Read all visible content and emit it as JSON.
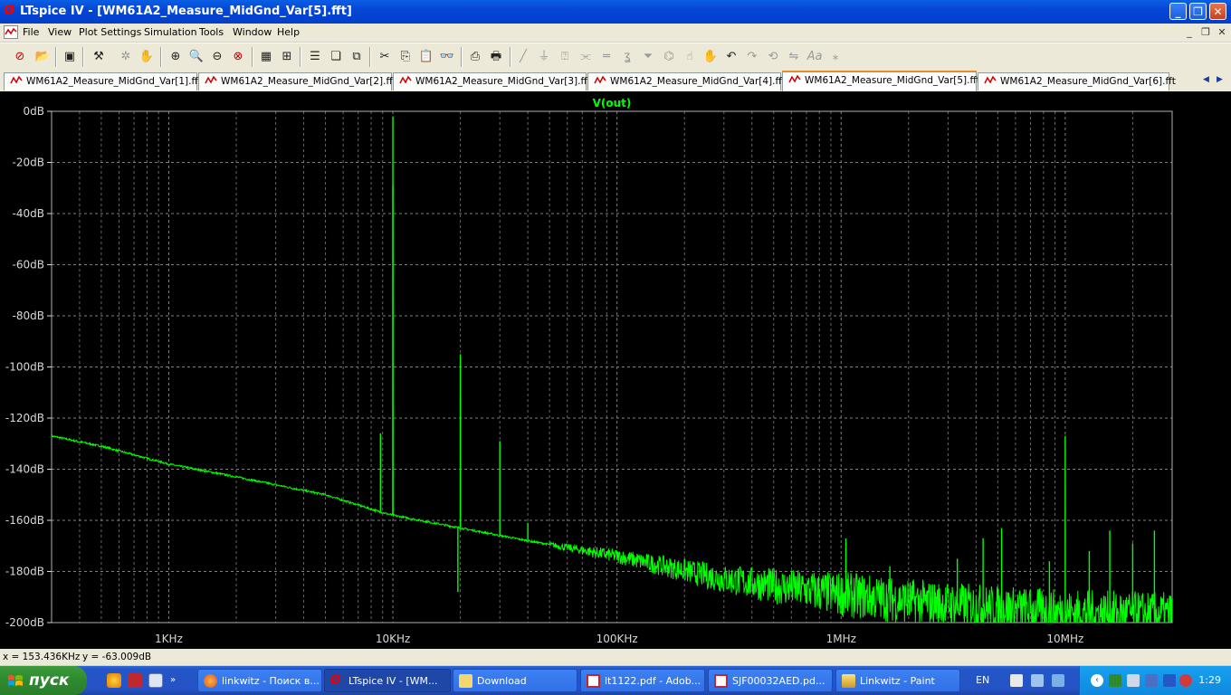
{
  "window": {
    "title": "LTspice IV - [WM61A2_Measure_MidGnd_Var[5].fft]",
    "app_icon": "ltspice-logo-icon",
    "controls": [
      "minimize-icon",
      "restore-icon",
      "close-icon"
    ]
  },
  "menu": {
    "items": [
      "File",
      "View",
      "Plot Settings",
      "Simulation",
      "Tools",
      "Window",
      "Help"
    ],
    "mdi_controls": [
      "_",
      "❐",
      "✕"
    ]
  },
  "toolbar": {
    "icons": [
      "new-schematic-icon",
      "open-icon",
      "save-icon",
      "control-panel-icon",
      "run-icon",
      "pan-hand-icon",
      "zoom-in-icon",
      "zoom-area-icon",
      "zoom-out-icon",
      "zoom-cancel-icon",
      "autorange-icon",
      "grid-icon",
      "tile-horizontal-icon",
      "cascade-icon",
      "tile-vertical-icon",
      "cut-icon",
      "copy-icon",
      "paste-icon",
      "find-icon",
      "print-preview-icon",
      "print-icon",
      "wire-icon",
      "ground-icon",
      "label-icon",
      "resistor-icon",
      "capacitor-icon",
      "inductor-icon",
      "diode-icon",
      "component-icon",
      "move-icon",
      "drag-icon",
      "undo-icon",
      "redo-icon",
      "rotate-icon",
      "mirror-icon",
      "text-icon",
      "spice-directive-icon"
    ]
  },
  "tabs": [
    {
      "label": "WM61A2_Measure_MidGnd_Var[1].fft",
      "active": false
    },
    {
      "label": "WM61A2_Measure_MidGnd_Var[2].fft",
      "active": false
    },
    {
      "label": "WM61A2_Measure_MidGnd_Var[3].fft",
      "active": false
    },
    {
      "label": "WM61A2_Measure_MidGnd_Var[4].fft",
      "active": false
    },
    {
      "label": "WM61A2_Measure_MidGnd_Var[5].fft",
      "active": true
    },
    {
      "label": "WM61A2_Measure_MidGnd_Var[6].fft",
      "active": false
    }
  ],
  "colors": {
    "trace": "#00ff00",
    "plot_background": "#000000",
    "grid": "#808080",
    "axis_text": "#d8d8d8",
    "trace_title": "#00ff00"
  },
  "chart_data": {
    "type": "line",
    "title": "V(out)",
    "x_scale": "log",
    "x_unit": "Hz",
    "xlim": [
      300,
      30000000
    ],
    "ylim": [
      -200,
      0
    ],
    "y_unit": "dB",
    "grid": true,
    "x_tick_values": [
      1000,
      10000,
      100000,
      1000000,
      10000000
    ],
    "x_tick_labels": [
      "1KHz",
      "10KHz",
      "100KHz",
      "1MHz",
      "10MHz"
    ],
    "y_tick_values": [
      0,
      -20,
      -40,
      -60,
      -80,
      -100,
      -120,
      -140,
      -160,
      -180,
      -200
    ],
    "y_tick_labels": [
      "0dB",
      "-20dB",
      "-40dB",
      "-60dB",
      "-80dB",
      "-100dB",
      "-120dB",
      "-140dB",
      "-160dB",
      "-180dB",
      "-200dB"
    ],
    "series": [
      {
        "name": "V(out)",
        "noise_floor": {
          "x": [
            300,
            500,
            1000,
            2000,
            5000,
            9000,
            10000,
            20000,
            40000,
            100000,
            300000,
            1000000,
            3000000,
            10000000,
            30000000
          ],
          "y": [
            -127,
            -131,
            -138,
            -143,
            -150,
            -157,
            -158,
            -163,
            -168,
            -174,
            -183,
            -189,
            -193,
            -196,
            -197
          ]
        },
        "peaks": [
          {
            "x": 8800,
            "y": -126
          },
          {
            "x": 10000,
            "y": -2
          },
          {
            "x": 10000,
            "y": -29
          },
          {
            "x": 19500,
            "y": -188
          },
          {
            "x": 20000,
            "y": -95
          },
          {
            "x": 20000,
            "y": -112
          },
          {
            "x": 30000,
            "y": -129
          },
          {
            "x": 40000,
            "y": -161
          },
          {
            "x": 1050000,
            "y": -167
          },
          {
            "x": 1650000,
            "y": -178
          },
          {
            "x": 3300000,
            "y": -175
          },
          {
            "x": 4300000,
            "y": -167
          },
          {
            "x": 5200000,
            "y": -163
          },
          {
            "x": 8500000,
            "y": -176
          },
          {
            "x": 10000000,
            "y": -127
          },
          {
            "x": 12800000,
            "y": -172
          },
          {
            "x": 15800000,
            "y": -164
          },
          {
            "x": 20000000,
            "y": -169
          },
          {
            "x": 25000000,
            "y": -164
          }
        ]
      }
    ]
  },
  "status": {
    "cursor_x": "x = 153.436KHz",
    "cursor_y": "y = -63.009dB"
  },
  "taskbar": {
    "start_label": "пуск",
    "quick_launch": [
      "chrome-like-icon",
      "pdf-reader-icon",
      "media-icon",
      "overflow-chevron-icon"
    ],
    "tasks": [
      {
        "label": "linkwitz - Поиск в...",
        "icon": "firefox-icon",
        "active": false
      },
      {
        "label": "LTspice IV - [WM...",
        "icon": "ltspice-icon",
        "active": true
      },
      {
        "label": "Download",
        "icon": "folder-icon",
        "active": false
      },
      {
        "label": "lt1122.pdf - Adob...",
        "icon": "acrobat-icon",
        "active": false
      },
      {
        "label": "SJF00032AED.pd...",
        "icon": "acrobat-icon",
        "active": false
      },
      {
        "label": "Linkwitz - Paint",
        "icon": "paint-icon",
        "active": false
      }
    ],
    "language": "EN",
    "clock": "1:29"
  }
}
